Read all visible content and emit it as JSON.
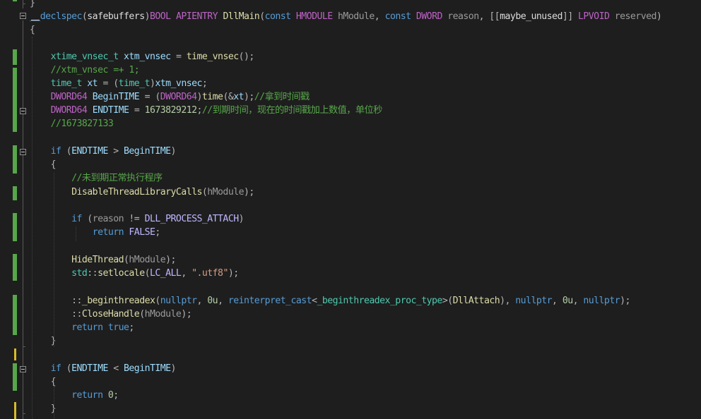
{
  "editor": {
    "lines": [
      {
        "id": "l0",
        "tokens": [
          [
            "t-punc",
            "}"
          ]
        ]
      },
      {
        "id": "l1",
        "tokens": [
          [
            "t-declspec",
            "__declspec"
          ],
          [
            "t-punc",
            "("
          ],
          [
            "t-plain",
            "safebuffers"
          ],
          [
            "t-punc",
            ")"
          ],
          [
            "t-macro",
            "BOOL"
          ],
          [
            "t-plain",
            " "
          ],
          [
            "t-macro",
            "APIENTRY"
          ],
          [
            "t-plain",
            " "
          ],
          [
            "t-func",
            "DllMain"
          ],
          [
            "t-punc",
            "("
          ],
          [
            "t-kw",
            "const"
          ],
          [
            "t-plain",
            " "
          ],
          [
            "t-macro",
            "HMODULE"
          ],
          [
            "t-plain",
            " "
          ],
          [
            "t-param",
            "hModule"
          ],
          [
            "t-punc",
            ","
          ],
          [
            "t-plain",
            " "
          ],
          [
            "t-kw",
            "const"
          ],
          [
            "t-plain",
            " "
          ],
          [
            "t-macro",
            "DWORD"
          ],
          [
            "t-plain",
            " "
          ],
          [
            "t-param",
            "reason"
          ],
          [
            "t-punc",
            ","
          ],
          [
            "t-plain",
            " "
          ],
          [
            "t-punc",
            "[["
          ],
          [
            "t-attr",
            "maybe_unused"
          ],
          [
            "t-punc",
            "]]"
          ],
          [
            "t-plain",
            " "
          ],
          [
            "t-macro",
            "LPVOID"
          ],
          [
            "t-plain",
            " "
          ],
          [
            "t-param",
            "reserved"
          ],
          [
            "t-punc",
            ")"
          ]
        ]
      },
      {
        "id": "l2",
        "tokens": [
          [
            "t-punc",
            "{"
          ]
        ]
      },
      {
        "id": "l3",
        "tokens": []
      },
      {
        "id": "l4",
        "tokens": [
          [
            "t-plain",
            "    "
          ],
          [
            "t-type",
            "xtime_vnsec_t"
          ],
          [
            "t-plain",
            " "
          ],
          [
            "t-local",
            "xtm_vnsec"
          ],
          [
            "t-plain",
            " "
          ],
          [
            "t-punc",
            "="
          ],
          [
            "t-plain",
            " "
          ],
          [
            "t-func",
            "time_vnsec"
          ],
          [
            "t-punc",
            "();"
          ]
        ]
      },
      {
        "id": "l5",
        "tokens": [
          [
            "t-plain",
            "    "
          ],
          [
            "t-com",
            "//xtm_vnsec =+ 1;"
          ]
        ]
      },
      {
        "id": "l6",
        "tokens": [
          [
            "t-plain",
            "    "
          ],
          [
            "t-type",
            "time_t"
          ],
          [
            "t-plain",
            " "
          ],
          [
            "t-local",
            "xt"
          ],
          [
            "t-plain",
            " "
          ],
          [
            "t-punc",
            "="
          ],
          [
            "t-plain",
            " "
          ],
          [
            "t-punc",
            "("
          ],
          [
            "t-type",
            "time_t"
          ],
          [
            "t-punc",
            ")"
          ],
          [
            "t-local",
            "xtm_vnsec"
          ],
          [
            "t-punc",
            ";"
          ]
        ]
      },
      {
        "id": "l7",
        "tokens": [
          [
            "t-plain",
            "    "
          ],
          [
            "t-macro",
            "DWORD64"
          ],
          [
            "t-plain",
            " "
          ],
          [
            "t-local",
            "BeginTIME"
          ],
          [
            "t-plain",
            " "
          ],
          [
            "t-punc",
            "="
          ],
          [
            "t-plain",
            " "
          ],
          [
            "t-punc",
            "("
          ],
          [
            "t-macro",
            "DWORD64"
          ],
          [
            "t-punc",
            ")"
          ],
          [
            "t-func",
            "time"
          ],
          [
            "t-punc",
            "(&"
          ],
          [
            "t-local",
            "xt"
          ],
          [
            "t-punc",
            ");"
          ],
          [
            "t-com",
            "//拿到时间戳"
          ]
        ]
      },
      {
        "id": "l8",
        "tokens": [
          [
            "t-plain",
            "    "
          ],
          [
            "t-macro",
            "DWORD64"
          ],
          [
            "t-plain",
            " "
          ],
          [
            "t-local",
            "ENDTIME"
          ],
          [
            "t-plain",
            " "
          ],
          [
            "t-punc",
            "="
          ],
          [
            "t-plain",
            " "
          ],
          [
            "t-num",
            "1673829212"
          ],
          [
            "t-punc",
            ";"
          ],
          [
            "t-com",
            "//到期时间，现在的时间戳加上数值，单位秒"
          ]
        ]
      },
      {
        "id": "l9",
        "tokens": [
          [
            "t-plain",
            "    "
          ],
          [
            "t-com",
            "//1673827133"
          ]
        ]
      },
      {
        "id": "l10",
        "tokens": []
      },
      {
        "id": "l11",
        "tokens": [
          [
            "t-plain",
            "    "
          ],
          [
            "t-kw",
            "if"
          ],
          [
            "t-plain",
            " "
          ],
          [
            "t-punc",
            "("
          ],
          [
            "t-local",
            "ENDTIME"
          ],
          [
            "t-plain",
            " "
          ],
          [
            "t-punc",
            ">"
          ],
          [
            "t-plain",
            " "
          ],
          [
            "t-local",
            "BeginTIME"
          ],
          [
            "t-punc",
            ")"
          ]
        ]
      },
      {
        "id": "l12",
        "tokens": [
          [
            "t-plain",
            "    "
          ],
          [
            "t-punc",
            "{"
          ]
        ]
      },
      {
        "id": "l13",
        "tokens": [
          [
            "t-plain",
            "        "
          ],
          [
            "t-com",
            "//未到期正常执行程序"
          ]
        ]
      },
      {
        "id": "l14",
        "tokens": [
          [
            "t-plain",
            "        "
          ],
          [
            "t-func",
            "DisableThreadLibraryCalls"
          ],
          [
            "t-punc",
            "("
          ],
          [
            "t-param",
            "hModule"
          ],
          [
            "t-punc",
            ");"
          ]
        ]
      },
      {
        "id": "l15",
        "tokens": []
      },
      {
        "id": "l16",
        "tokens": [
          [
            "t-plain",
            "        "
          ],
          [
            "t-kw",
            "if"
          ],
          [
            "t-plain",
            " "
          ],
          [
            "t-punc",
            "("
          ],
          [
            "t-param",
            "reason"
          ],
          [
            "t-plain",
            " "
          ],
          [
            "t-punc",
            "!="
          ],
          [
            "t-plain",
            " "
          ],
          [
            "t-macroc",
            "DLL_PROCESS_ATTACH"
          ],
          [
            "t-punc",
            ")"
          ]
        ]
      },
      {
        "id": "l17",
        "tokens": [
          [
            "t-plain",
            "            "
          ],
          [
            "t-kw",
            "return"
          ],
          [
            "t-plain",
            " "
          ],
          [
            "t-macroc",
            "FALSE"
          ],
          [
            "t-punc",
            ";"
          ]
        ]
      },
      {
        "id": "l18",
        "tokens": []
      },
      {
        "id": "l19",
        "tokens": [
          [
            "t-plain",
            "        "
          ],
          [
            "t-func",
            "HideThread"
          ],
          [
            "t-punc",
            "("
          ],
          [
            "t-param",
            "hModule"
          ],
          [
            "t-punc",
            ");"
          ]
        ]
      },
      {
        "id": "l20",
        "tokens": [
          [
            "t-plain",
            "        "
          ],
          [
            "t-type",
            "std"
          ],
          [
            "t-punc",
            "::"
          ],
          [
            "t-func",
            "setlocale"
          ],
          [
            "t-punc",
            "("
          ],
          [
            "t-macroc",
            "LC_ALL"
          ],
          [
            "t-punc",
            ","
          ],
          [
            "t-plain",
            " "
          ],
          [
            "t-str",
            "\".utf8\""
          ],
          [
            "t-punc",
            ");"
          ]
        ]
      },
      {
        "id": "l21",
        "tokens": []
      },
      {
        "id": "l22",
        "tokens": [
          [
            "t-plain",
            "        "
          ],
          [
            "t-punc",
            "::"
          ],
          [
            "t-func",
            "_beginthreadex"
          ],
          [
            "t-punc",
            "("
          ],
          [
            "t-kw",
            "nullptr"
          ],
          [
            "t-punc",
            ","
          ],
          [
            "t-plain",
            " "
          ],
          [
            "t-num",
            "0u"
          ],
          [
            "t-punc",
            ","
          ],
          [
            "t-plain",
            " "
          ],
          [
            "t-kw",
            "reinterpret_cast"
          ],
          [
            "t-punc",
            "<"
          ],
          [
            "t-type",
            "_beginthreadex_proc_type"
          ],
          [
            "t-punc",
            ">("
          ],
          [
            "t-func",
            "DllAttach"
          ],
          [
            "t-punc",
            "),"
          ],
          [
            "t-plain",
            " "
          ],
          [
            "t-kw",
            "nullptr"
          ],
          [
            "t-punc",
            ","
          ],
          [
            "t-plain",
            " "
          ],
          [
            "t-num",
            "0u"
          ],
          [
            "t-punc",
            ","
          ],
          [
            "t-plain",
            " "
          ],
          [
            "t-kw",
            "nullptr"
          ],
          [
            "t-punc",
            ");"
          ]
        ]
      },
      {
        "id": "l23",
        "tokens": [
          [
            "t-plain",
            "        "
          ],
          [
            "t-punc",
            "::"
          ],
          [
            "t-func",
            "CloseHandle"
          ],
          [
            "t-punc",
            "("
          ],
          [
            "t-param",
            "hModule"
          ],
          [
            "t-punc",
            ");"
          ]
        ]
      },
      {
        "id": "l24",
        "tokens": [
          [
            "t-plain",
            "        "
          ],
          [
            "t-kw",
            "return"
          ],
          [
            "t-plain",
            " "
          ],
          [
            "t-kw",
            "true"
          ],
          [
            "t-punc",
            ";"
          ]
        ]
      },
      {
        "id": "l25",
        "tokens": [
          [
            "t-plain",
            "    "
          ],
          [
            "t-punc",
            "}"
          ]
        ]
      },
      {
        "id": "l26",
        "tokens": []
      },
      {
        "id": "l27",
        "tokens": [
          [
            "t-plain",
            "    "
          ],
          [
            "t-kw",
            "if"
          ],
          [
            "t-plain",
            " "
          ],
          [
            "t-punc",
            "("
          ],
          [
            "t-local",
            "ENDTIME"
          ],
          [
            "t-plain",
            " "
          ],
          [
            "t-punc",
            "<"
          ],
          [
            "t-plain",
            " "
          ],
          [
            "t-local",
            "BeginTIME"
          ],
          [
            "t-punc",
            ")"
          ]
        ]
      },
      {
        "id": "l28",
        "tokens": [
          [
            "t-plain",
            "    "
          ],
          [
            "t-punc",
            "{"
          ]
        ]
      },
      {
        "id": "l29",
        "tokens": [
          [
            "t-plain",
            "        "
          ],
          [
            "t-kw",
            "return"
          ],
          [
            "t-plain",
            " "
          ],
          [
            "t-num",
            "0"
          ],
          [
            "t-punc",
            ";"
          ]
        ]
      },
      {
        "id": "l30",
        "tokens": [
          [
            "t-plain",
            "    "
          ],
          [
            "t-punc",
            "}"
          ]
        ]
      }
    ]
  },
  "theme": {
    "background": "#1e1e1e",
    "saved_change_color": "#57a64a",
    "unsaved_change_color": "#d7ba2a"
  }
}
